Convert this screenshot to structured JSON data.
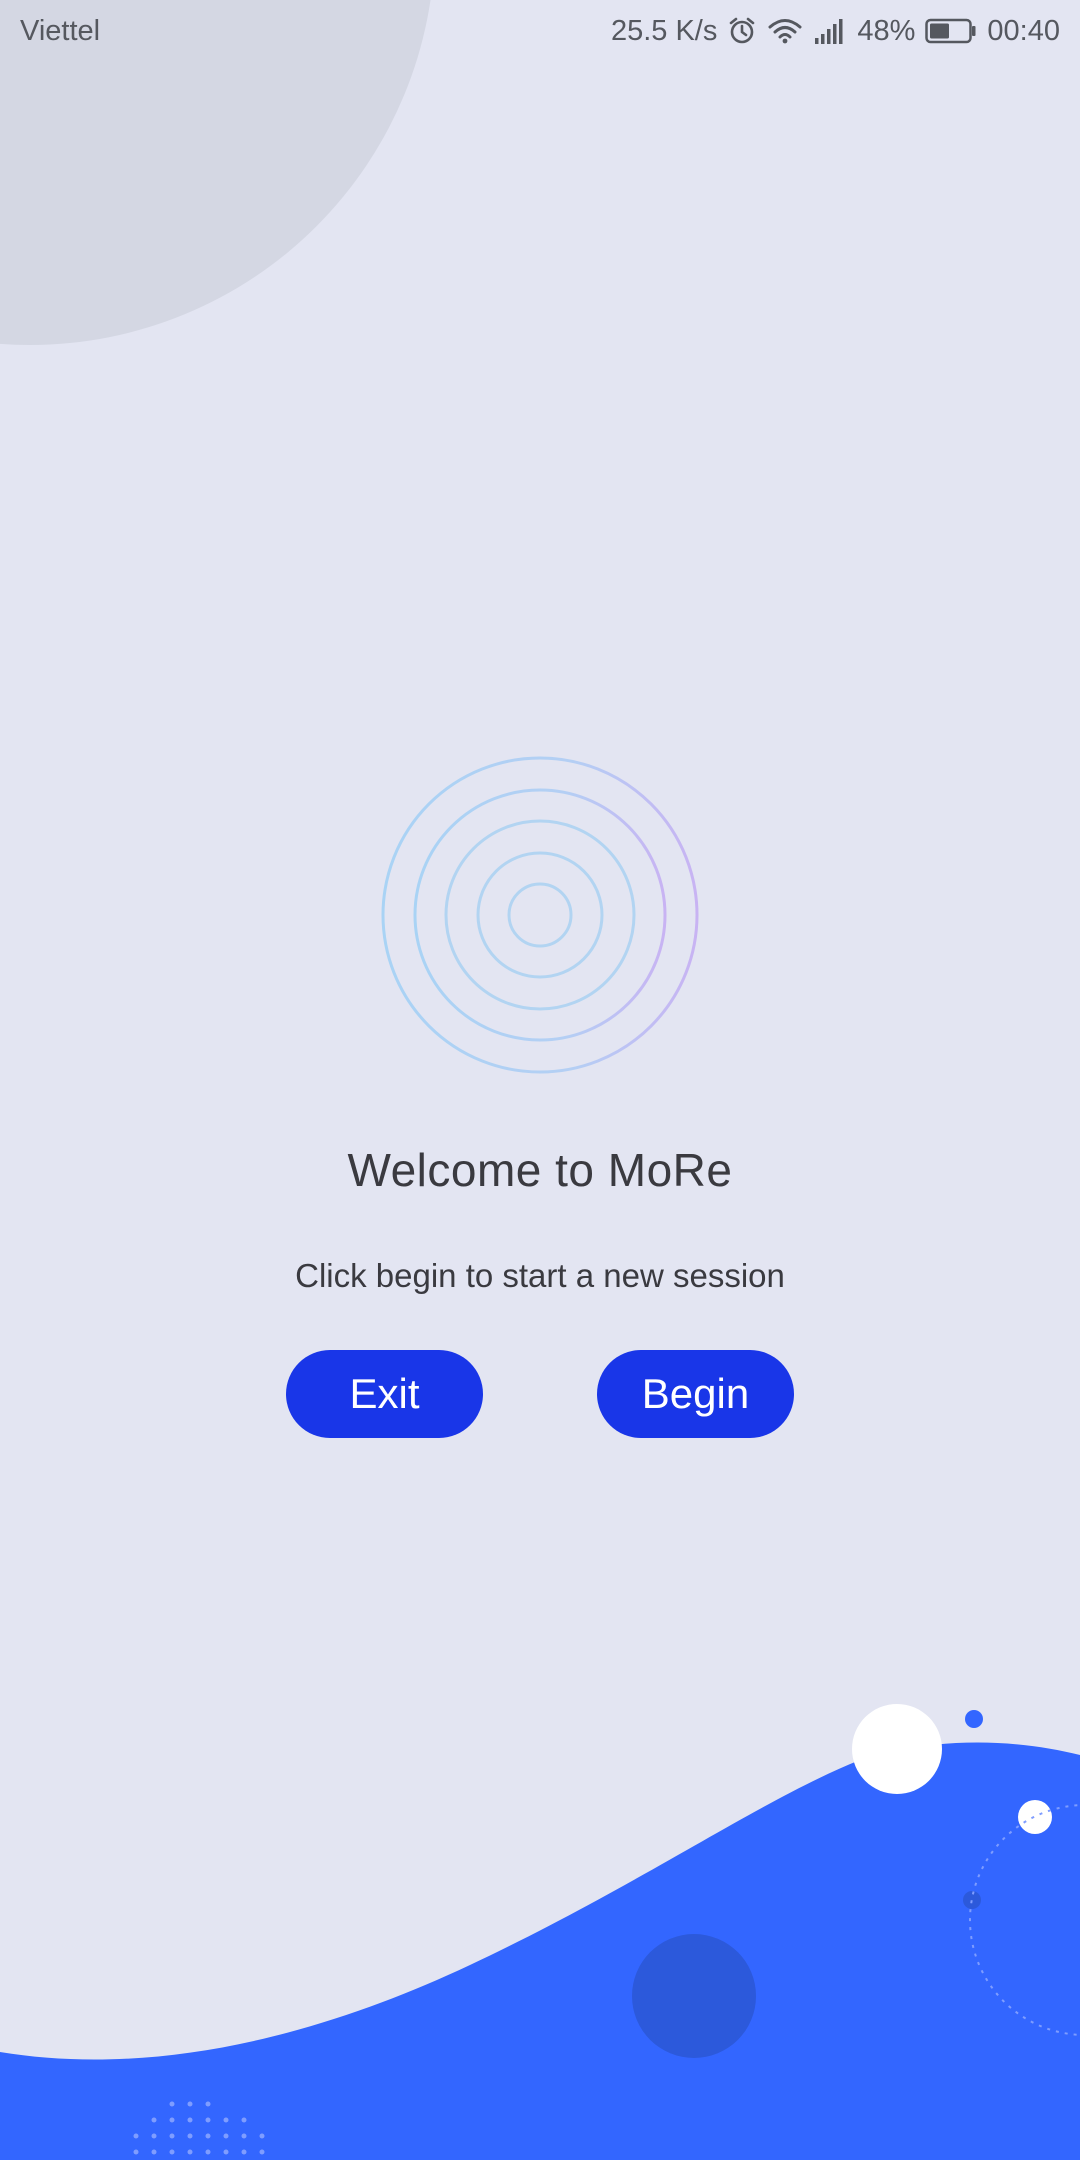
{
  "status_bar": {
    "carrier": "Viettel",
    "network_speed": "25.5 K/s",
    "battery_percent": "48%",
    "time": "00:40",
    "icons": [
      "alarm-icon",
      "wifi-icon",
      "signal-icon",
      "battery-icon"
    ]
  },
  "welcome": {
    "title": "Welcome to MoRe",
    "subtitle": "Click begin to start a new session"
  },
  "buttons": {
    "exit_label": "Exit",
    "begin_label": "Begin"
  },
  "colors": {
    "background": "#e3e5f2",
    "button": "#1936e8",
    "wave": "#3366ff"
  }
}
